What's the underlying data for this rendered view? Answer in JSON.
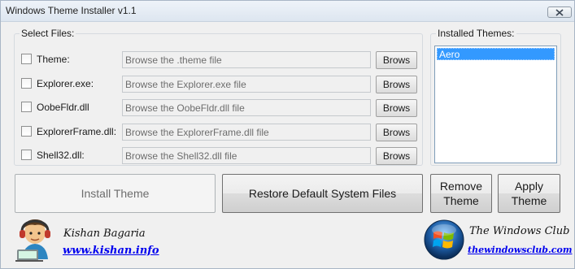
{
  "window": {
    "title": "Windows Theme Installer v1.1"
  },
  "files": {
    "legend": "Select Files:",
    "rows": [
      {
        "label": "Theme:",
        "placeholder": "Browse the .theme file",
        "button": "Brows",
        "checked": false
      },
      {
        "label": "Explorer.exe:",
        "placeholder": "Browse the Explorer.exe file",
        "button": "Brows",
        "checked": false
      },
      {
        "label": "OobeFldr.dll",
        "placeholder": "Browse the OobeFldr.dll file",
        "button": "Brows",
        "checked": false
      },
      {
        "label": "ExplorerFrame.dll:",
        "placeholder": "Browse the ExplorerFrame.dll file",
        "button": "Brows",
        "checked": false
      },
      {
        "label": "Shell32.dll:",
        "placeholder": "Browse the Shell32.dll file",
        "button": "Brows",
        "checked": false
      }
    ]
  },
  "themes": {
    "legend": "Installed Themes:",
    "items": [
      "Aero"
    ],
    "selected": "Aero"
  },
  "actions": {
    "install": "Install Theme",
    "restore": "Restore Default System Files",
    "remove_line1": "Remove",
    "remove_line2": "Theme",
    "apply_line1": "Apply",
    "apply_line2": "Theme"
  },
  "footer": {
    "author_name": "Kishan Bagaria",
    "author_link": "www.kishan.info",
    "club_name": "The Windows Club",
    "club_link": "thewindowsclub.com"
  },
  "colors": {
    "selection": "#3399ff",
    "link": "#0000ee",
    "window_bg": "#f0f0f0"
  },
  "icons": {
    "close": "close-icon",
    "avatar": "avatar-icon",
    "windows_logo": "windows-logo-icon"
  }
}
